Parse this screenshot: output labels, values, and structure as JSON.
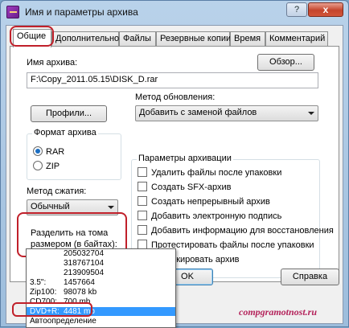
{
  "window": {
    "title": "Имя и параметры архива",
    "help_label": "?",
    "close_label": "x"
  },
  "tabs": [
    {
      "label": "Общие",
      "active": true
    },
    {
      "label": "Дополнительно"
    },
    {
      "label": "Файлы"
    },
    {
      "label": "Резервные копии"
    },
    {
      "label": "Время"
    },
    {
      "label": "Комментарий"
    }
  ],
  "archive_name": {
    "label": "Имя архива:",
    "value": "F:\\Copy_2011.05.15\\DISK_D.rar",
    "browse_label": "Обзор..."
  },
  "profiles_label": "Профили...",
  "update_method": {
    "label": "Метод обновления:",
    "value": "Добавить с заменой файлов"
  },
  "archive_format": {
    "title": "Формат архива",
    "options": [
      {
        "label": "RAR",
        "checked": true
      },
      {
        "label": "ZIP",
        "checked": false
      }
    ]
  },
  "archive_params": {
    "title": "Параметры архивации",
    "options": [
      "Удалить файлы после упаковки",
      "Создать SFX-архив",
      "Создать непрерывный архив",
      "Добавить электронную подпись",
      "Добавить информацию для восстановления",
      "Протестировать файлы после упаковки",
      "Заблокировать архив"
    ]
  },
  "compression": {
    "label": "Метод сжатия:",
    "value": "Обычный"
  },
  "split": {
    "label_line1": "Разделить на тома",
    "label_line2": "размером (в байтах):",
    "value": "",
    "options": [
      {
        "name": "",
        "value": "205032704"
      },
      {
        "name": "",
        "value": "318767104"
      },
      {
        "name": "",
        "value": "213909504"
      },
      {
        "name": "3.5\":",
        "value": "1457664"
      },
      {
        "name": "Zip100:",
        "value": "98078 kb"
      },
      {
        "name": "CD700:",
        "value": "700 mb"
      },
      {
        "name": "DVD+R:",
        "value": "4481 mb",
        "selected": true
      },
      {
        "name": "Автоопределение",
        "value": ""
      }
    ]
  },
  "buttons": {
    "ok": "OK",
    "help": "Справка"
  },
  "watermark": "compgramotnost.ru",
  "colors": {
    "highlight_ring": "#c0202a",
    "selection": "#3399ff"
  }
}
